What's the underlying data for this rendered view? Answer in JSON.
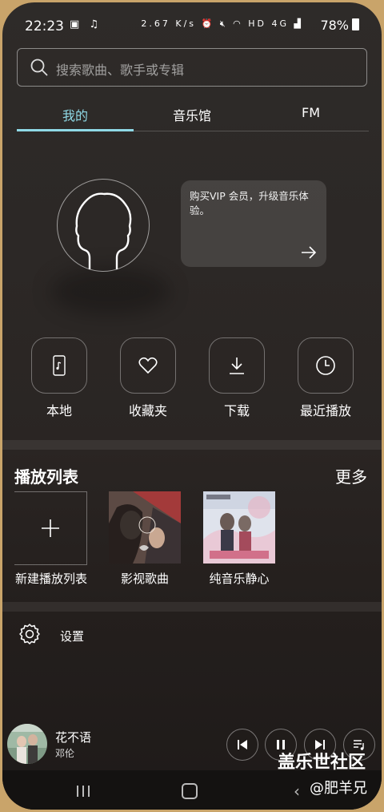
{
  "status_bar": {
    "time": "22:23",
    "net_speed": "2.67 K/s",
    "network": "HD 4G",
    "battery": "78%"
  },
  "search": {
    "placeholder": "搜索歌曲、歌手或专辑"
  },
  "tabs": [
    {
      "label": "我的",
      "active": true
    },
    {
      "label": "音乐馆",
      "active": false
    },
    {
      "label": "FM",
      "active": false
    }
  ],
  "vip_card": {
    "text": "购买VIP 会员，升级音乐体验。"
  },
  "quick_actions": [
    {
      "label": "本地",
      "icon": "phone-music-icon"
    },
    {
      "label": "收藏夹",
      "icon": "heart-icon"
    },
    {
      "label": "下载",
      "icon": "download-icon"
    },
    {
      "label": "最近播放",
      "icon": "clock-icon"
    }
  ],
  "playlists": {
    "title": "播放列表",
    "more": "更多",
    "items": [
      {
        "label": "新建播放列表",
        "icon": "plus-icon"
      },
      {
        "label": "影视歌曲"
      },
      {
        "label": "纯音乐静心"
      }
    ]
  },
  "settings": {
    "label": "设置"
  },
  "now_playing": {
    "title": "花不语",
    "artist": "邓伦"
  },
  "watermark": {
    "line1": "盖乐世社区",
    "line2": "@肥羊兄"
  },
  "colors": {
    "accent": "#8fd9e6"
  }
}
